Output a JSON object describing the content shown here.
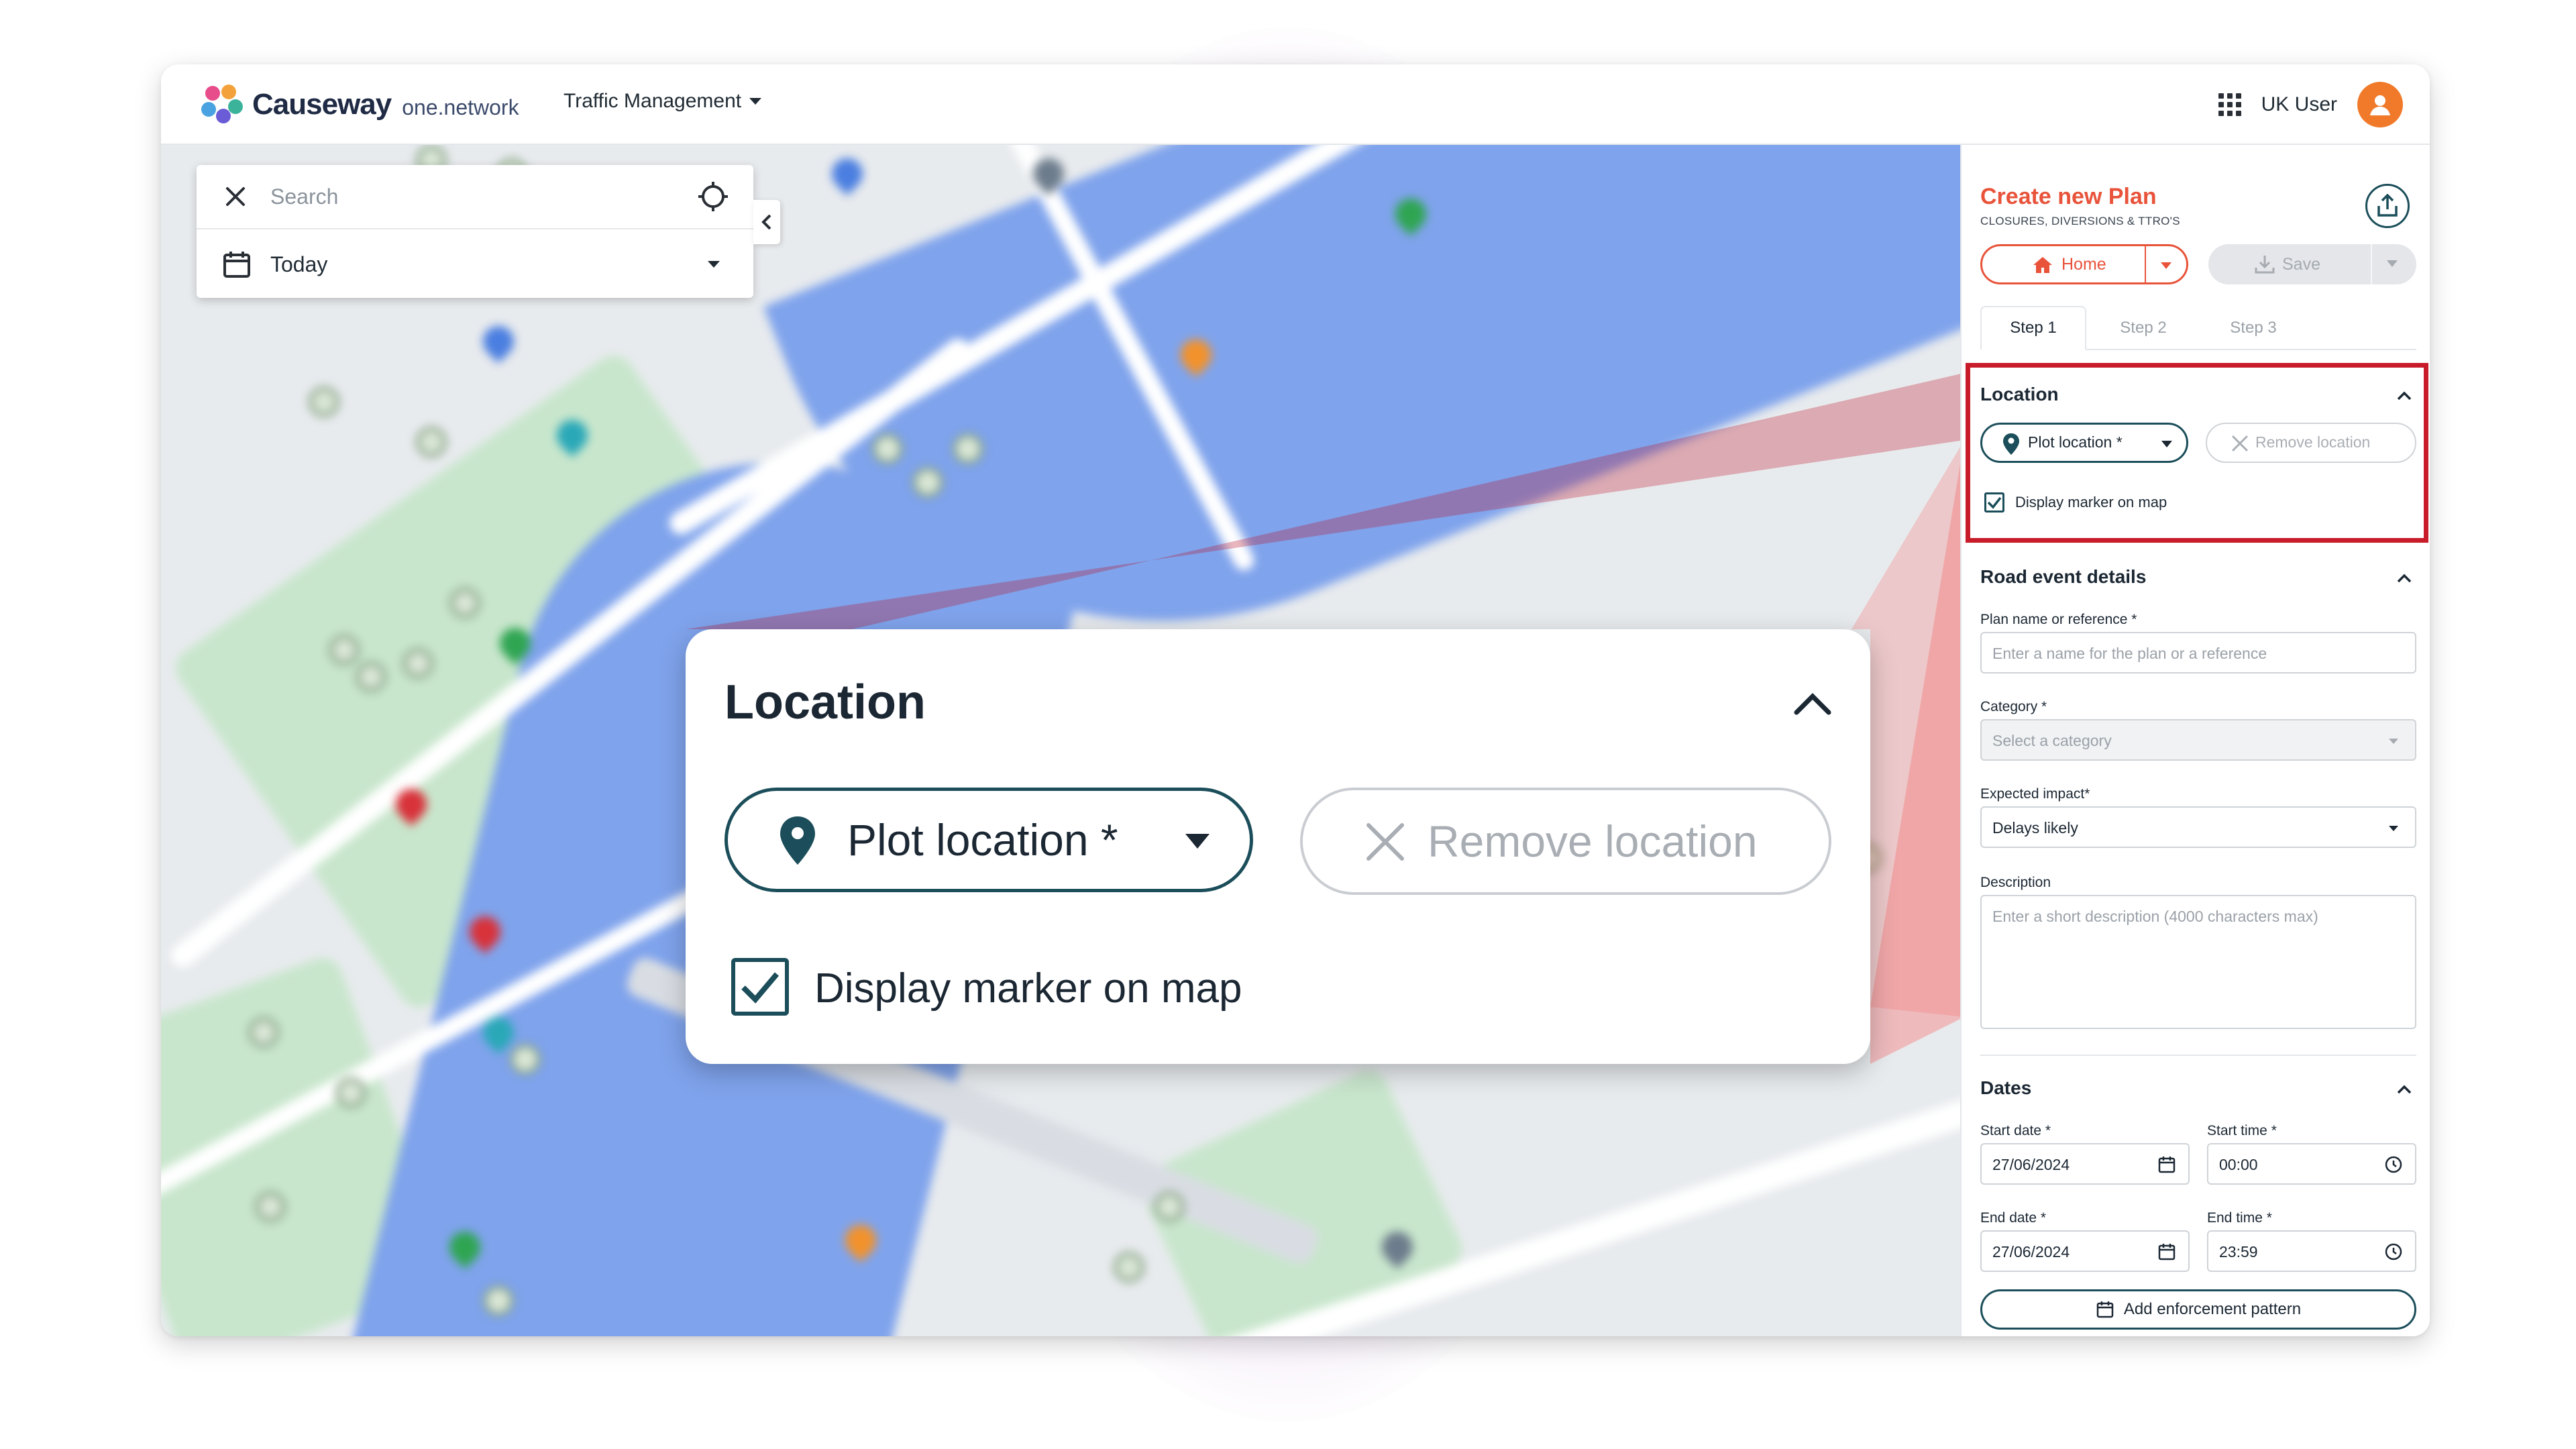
{
  "app": {
    "brand_word": "Causeway",
    "brand_sub": "one.network",
    "module_menu": "Traffic Management",
    "user_name": "UK User"
  },
  "map_panel": {
    "search_placeholder": "Search",
    "date_filter": "Today"
  },
  "zoom": {
    "title": "Location",
    "plot_label": "Plot location *",
    "remove_label": "Remove location",
    "checkbox_label": "Display marker on map",
    "checkbox_checked": true
  },
  "plan": {
    "title": "Create new Plan",
    "subtitle": "CLOSURES, DIVERSIONS & TTRO'S",
    "home_label": "Home",
    "save_label": "Save",
    "steps": [
      "Step 1",
      "Step 2",
      "Step 3"
    ],
    "active_step": 0,
    "location": {
      "title": "Location",
      "plot_label": "Plot location *",
      "remove_label": "Remove location",
      "checkbox_label": "Display marker on map"
    },
    "road_event": {
      "title": "Road event details",
      "name_label": "Plan name or reference *",
      "name_placeholder": "Enter a name for the plan or a reference",
      "category_label": "Category *",
      "category_placeholder": "Select a category",
      "impact_label": "Expected impact*",
      "impact_value": "Delays likely",
      "description_label": "Description",
      "description_placeholder": "Enter a short description (4000 characters max)"
    },
    "dates": {
      "title": "Dates",
      "start_date_label": "Start date *",
      "start_date": "27/06/2024",
      "start_time_label": "Start time *",
      "start_time": "00:00",
      "end_date_label": "End date *",
      "end_date": "27/06/2024",
      "end_time_label": "End time *",
      "end_time": "23:59"
    },
    "enforcement_label": "Add enforcement pattern"
  },
  "colors": {
    "accent": "#e8533a",
    "primary": "#1b4e5a",
    "highlight": "#c81c2b",
    "user_avatar": "#f07a2a"
  }
}
